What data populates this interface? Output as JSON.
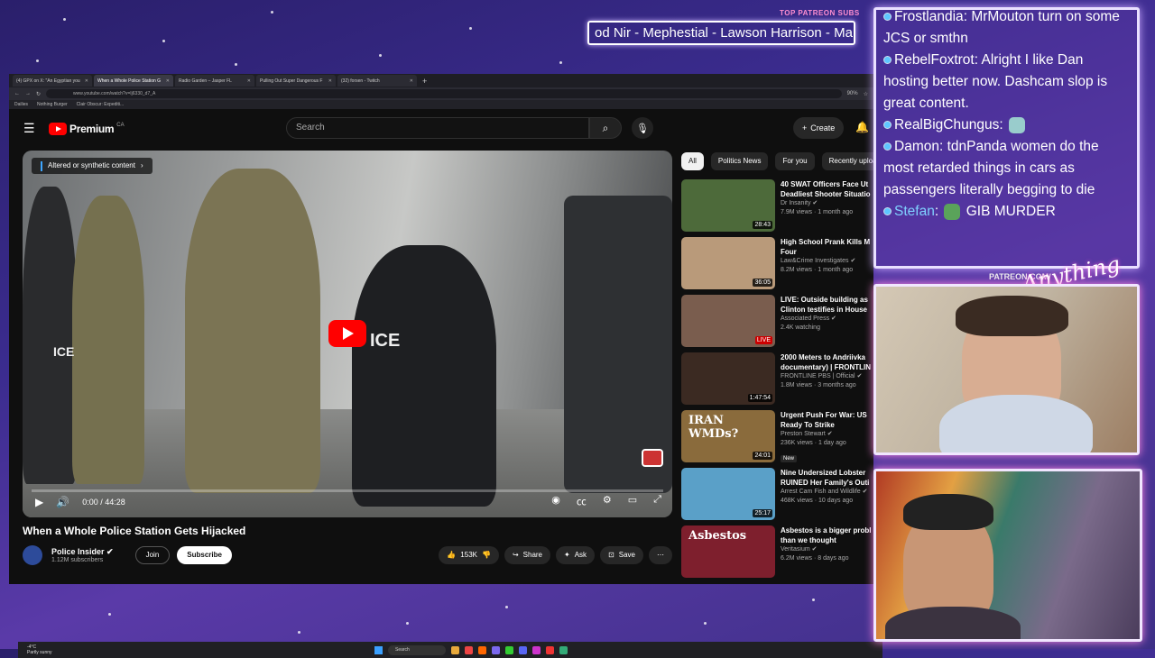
{
  "overlay": {
    "patreon_label": "TOP PATREON SUBS",
    "sub_ticker": "od Nir - Mephestial - Lawson Harrison - Ma",
    "patreon_url": "PATREON.COM/",
    "chat": [
      {
        "user": "Frostlandia",
        "text": "MrMouton turn on some JCS or smthn"
      },
      {
        "user": "RebelFoxtrot",
        "text": "Alright I like Dan hosting better now. Dashcam slop is great content."
      },
      {
        "user": "RealBigChungus",
        "text": ""
      },
      {
        "user": "Damon",
        "text": "tdnPanda women do the most retarded things in cars as passengers  literally begging to die "
      },
      {
        "user": "Stefan",
        "text": " GIB MURDER"
      }
    ]
  },
  "browser": {
    "tabs": [
      {
        "label": "(4) GPX on X: \"An Egyptian you"
      },
      {
        "label": "When a Whole Police Station G"
      },
      {
        "label": "Radio Garden – Jasper FL"
      },
      {
        "label": "Pulling Out Super Dangerous F"
      },
      {
        "label": "(32) forsen - Twitch"
      }
    ],
    "url": "www.youtube.com/watch?v=Ij6330_d7_A",
    "zoom": "90%",
    "bookmarks": [
      "Dailies",
      "Nothing Burger",
      "Clair Obscur: Expediti..."
    ]
  },
  "youtube": {
    "brand": "Premium",
    "region": "CA",
    "search_placeholder": "Search",
    "create_label": "Create",
    "video": {
      "label_chip": "Altered or synthetic content",
      "time": "0:00 / 44:28",
      "title": "When a Whole Police Station Gets Hijacked",
      "channel": "Police Insider",
      "subscribers": "1.12M subscribers",
      "join": "Join",
      "subscribe": "Subscribe",
      "likes": "153K",
      "share": "Share",
      "ask": "Ask",
      "save": "Save"
    },
    "chips": [
      "All",
      "Politics News",
      "For you",
      "Recently uploaded"
    ],
    "recommendations": [
      {
        "title1": "40 SWAT Officers Face Ut",
        "title2": "Deadliest Shooter Situatio",
        "channel": "Dr Insanity",
        "meta": "7.9M views · 1 month ago",
        "duration": "28:43",
        "color": "#4d6a3a"
      },
      {
        "title1": "High School Prank Kills M",
        "title2": "Four",
        "channel": "Law&Crime Investigates",
        "meta": "8.2M views · 1 month ago",
        "duration": "36:05",
        "color": "#b99a7a"
      },
      {
        "title1": "LIVE: Outside building as",
        "title2": "Clinton testifies in House",
        "channel": "Associated Press",
        "meta": "2.4K watching",
        "duration": "LIVE",
        "color": "#7a5d4e"
      },
      {
        "title1": "2000 Meters to Andriivka",
        "title2": "documentary) | FRONTLIN",
        "channel": "FRONTLINE PBS | Official",
        "meta": "1.8M views · 3 months ago",
        "duration": "1:47:54",
        "color": "#3b2a22"
      },
      {
        "title1": "Urgent Push For War: US",
        "title2": "Ready To Strike",
        "channel": "Preston Stewart",
        "meta": "236K views · 1 day ago",
        "badge": "New",
        "duration": "24:01",
        "color": "#8a6b3c",
        "overlay": "IRAN WMDs?"
      },
      {
        "title1": "Nine Undersized Lobster",
        "title2": "RUINED Her Family's Outi",
        "channel": "Arrest Cam Fish and Wildlife",
        "meta": "468K views · 10 days ago",
        "duration": "25:17",
        "color": "#5aa0c8"
      },
      {
        "title1": "Asbestos is a bigger probl",
        "title2": "than we thought",
        "channel": "Veritasium",
        "meta": "6.2M views · 8 days ago",
        "duration": "",
        "color": "#7e1f2d",
        "overlay": "Asbestos"
      }
    ]
  },
  "taskbar": {
    "weather": "-4°C\nPartly sunny",
    "search": "Search"
  }
}
